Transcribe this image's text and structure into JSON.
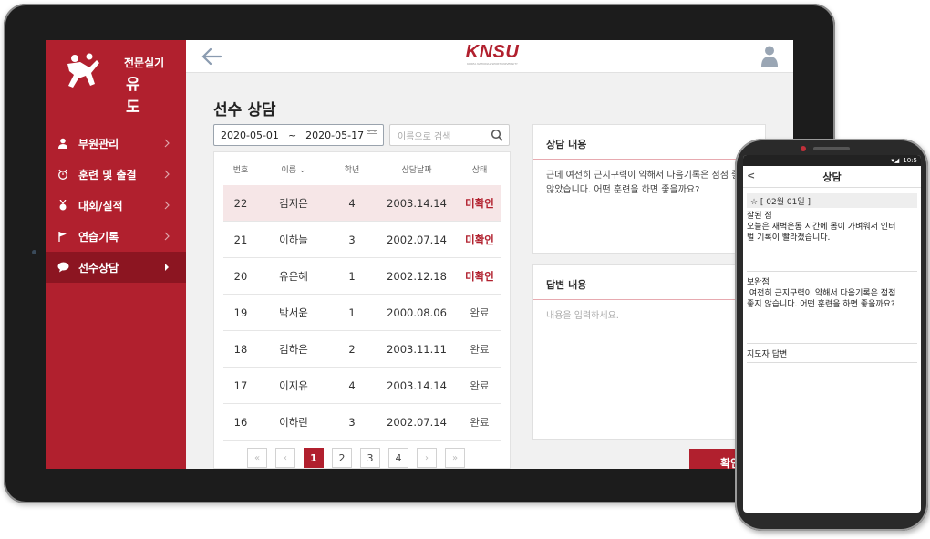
{
  "sidebar": {
    "brand_sub": "전문실기",
    "brand_main": "유도",
    "items": [
      {
        "label": "부원관리",
        "icon": "person-icon",
        "active": false
      },
      {
        "label": "훈련 및 출결",
        "icon": "stopwatch-icon",
        "active": false
      },
      {
        "label": "대회/실적",
        "icon": "medal-icon",
        "active": false
      },
      {
        "label": "연습기록",
        "icon": "flag-icon",
        "active": false
      },
      {
        "label": "선수상담",
        "icon": "chat-bubble-icon",
        "active": true
      }
    ]
  },
  "header": {
    "logo": "KNSU",
    "logo_sub": "KOREA NATIONAL SPORT UNIVERSITY"
  },
  "page_title": "선수 상담",
  "filters": {
    "date_from": "2020-05-01",
    "date_sep": "~",
    "date_to": "2020-05-17",
    "search_placeholder": "이름으로 검색"
  },
  "table": {
    "headers": [
      "번호",
      "이름 ⌄",
      "학년",
      "상담날짜",
      "상태"
    ],
    "rows": [
      {
        "no": "22",
        "name": "김지은",
        "grade": "4",
        "date": "2003.14.14",
        "status": "미확인",
        "pending": true,
        "selected": true
      },
      {
        "no": "21",
        "name": "이하늘",
        "grade": "3",
        "date": "2002.07.14",
        "status": "미확인",
        "pending": true,
        "selected": false
      },
      {
        "no": "20",
        "name": "유은혜",
        "grade": "1",
        "date": "2002.12.18",
        "status": "미확인",
        "pending": true,
        "selected": false
      },
      {
        "no": "19",
        "name": "박서윤",
        "grade": "1",
        "date": "2000.08.06",
        "status": "완료",
        "pending": false,
        "selected": false
      },
      {
        "no": "18",
        "name": "김하은",
        "grade": "2",
        "date": "2003.11.11",
        "status": "완료",
        "pending": false,
        "selected": false
      },
      {
        "no": "17",
        "name": "이지유",
        "grade": "4",
        "date": "2003.14.14",
        "status": "완료",
        "pending": false,
        "selected": false
      },
      {
        "no": "16",
        "name": "이하린",
        "grade": "3",
        "date": "2002.07.14",
        "status": "완료",
        "pending": false,
        "selected": false
      }
    ]
  },
  "pagination": {
    "first": "«",
    "prev": "‹",
    "pages": [
      "1",
      "2",
      "3",
      "4"
    ],
    "current": "1",
    "next": "›",
    "last": "»"
  },
  "consult_card": {
    "title": "상담 내용",
    "line1": "근데 여전히 근지구력이 약해서 다음기록은 점점 좋지",
    "line2": "않았습니다. 어떤 훈련을 하면 좋을까요?"
  },
  "reply_card": {
    "title": "답변 내용",
    "placeholder": "내용을 입력하세요."
  },
  "confirm_button": "확인",
  "colors": {
    "accent": "#b1202e",
    "accent_dark": "#8c1521",
    "selected_row": "#f6e6e7"
  },
  "phone": {
    "status_time": "10:5",
    "title": "상담",
    "back": "<",
    "date_label": "☆ [ 02월 01일 ]",
    "good_title": "잘된 점",
    "good_line1": "오늘은 새벽운동 시간에 몸이 가벼워서 인터",
    "good_line2": "벌 기록이 빨라졌습니다.",
    "improve_title": "보완점",
    "improve_line1": " 여전히 근지구력이 약해서 다음기록은 점점",
    "improve_line2": "좋지 않습니다. 어떤 훈련을 하면 좋을까요?",
    "coach_title": "지도자 답변"
  }
}
